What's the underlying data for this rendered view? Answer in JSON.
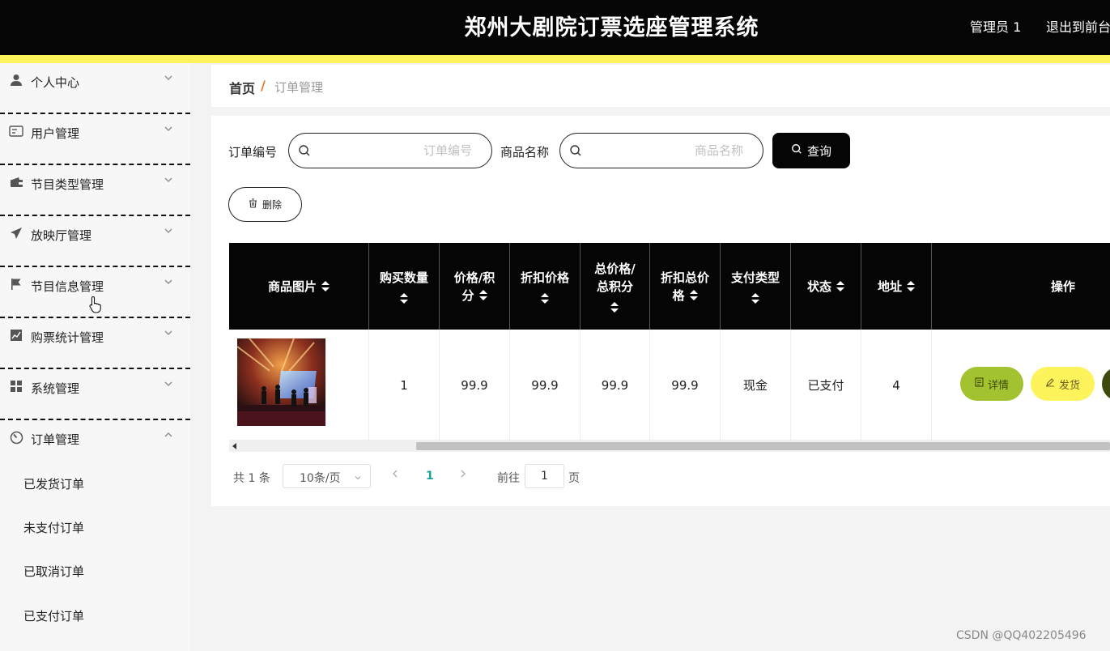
{
  "header": {
    "title": "郑州大剧院订票选座管理系统",
    "user": "管理员 1",
    "exit": "退出到前台"
  },
  "sidebar": {
    "items": [
      {
        "label": "个人中心",
        "icon": "person-icon"
      },
      {
        "label": "用户管理",
        "icon": "id-card-icon"
      },
      {
        "label": "节目类型管理",
        "icon": "wallet-icon"
      },
      {
        "label": "放映厅管理",
        "icon": "paper-plane-icon"
      },
      {
        "label": "节目信息管理",
        "icon": "flag-icon"
      },
      {
        "label": "购票统计管理",
        "icon": "chart-icon"
      },
      {
        "label": "系统管理",
        "icon": "grid-icon"
      },
      {
        "label": "订单管理",
        "icon": "gauge-icon"
      }
    ],
    "submenu": [
      "已发货订单",
      "未支付订单",
      "已取消订单",
      "已支付订单"
    ]
  },
  "breadcrumb": {
    "home": "首页",
    "separator": "/",
    "current": "订单管理"
  },
  "search": {
    "order_no_label": "订单编号",
    "order_no_placeholder": "订单编号",
    "product_label": "商品名称",
    "product_placeholder": "商品名称",
    "query_label": "查询"
  },
  "actions": {
    "delete_label": "删除"
  },
  "table": {
    "headers": {
      "image": "商品图片",
      "qty": "购买数量",
      "price_a": "价格/积",
      "price_b": "分",
      "discount": "折扣价格",
      "total_a": "总价格/",
      "total_b": "总积分",
      "dtotal_a": "折扣总价",
      "dtotal_b": "格",
      "pay_type": "支付类型",
      "status": "状态",
      "address": "地址",
      "ops": "操作"
    },
    "rows": [
      {
        "qty": "1",
        "price": "99.9",
        "discount": "99.9",
        "total": "99.9",
        "dtotal": "99.9",
        "pay_type": "现金",
        "status": "已支付",
        "address": "4"
      }
    ],
    "row_buttons": {
      "detail": "详情",
      "ship": "发货"
    }
  },
  "pagination": {
    "total": "共 1 条",
    "page_size": "10条/页",
    "current": "1",
    "goto_label": "前往",
    "goto_value": "1",
    "page_suffix": "页"
  },
  "watermark": "CSDN @QQ402205496",
  "colors": {
    "header_bg": "#050505",
    "accent_yellow": "#fdf35b",
    "detail_btn": "#a3c22f",
    "ship_btn": "#fdf35b",
    "page_active": "#1aa39a"
  }
}
